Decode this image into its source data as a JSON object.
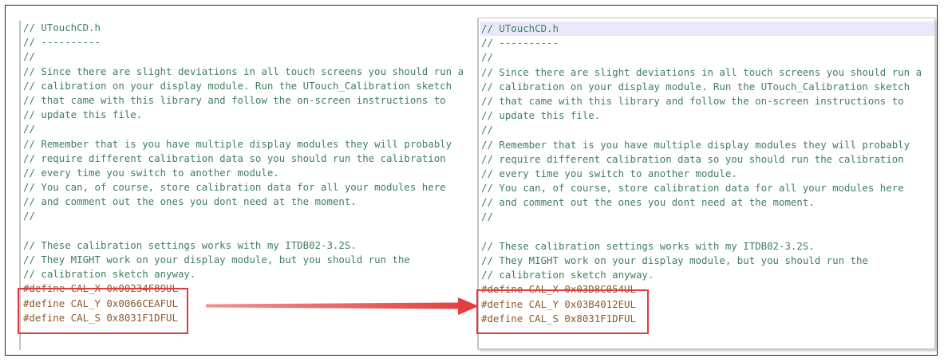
{
  "left_editor": {
    "lines": [
      "// UTouchCD.h",
      "// ----------",
      "//",
      "// Since there are slight deviations in all touch screens you should run a",
      "// calibration on your display module. Run the UTouch_Calibration sketch",
      "// that came with this library and follow the on-screen instructions to",
      "// update this file.",
      "//",
      "// Remember that is you have multiple display modules they will probably",
      "// require different calibration data so you should run the calibration",
      "// every time you switch to another module.",
      "// You can, of course, store calibration data for all your modules here",
      "// and comment out the ones you dont need at the moment.",
      "//",
      "",
      "// These calibration settings works with my ITDB02-3.2S.",
      "// They MIGHT work on your display module, but you should run the",
      "// calibration sketch anyway.",
      "#define CAL_X 0x00234F89UL",
      "#define CAL_Y 0x0066CEAFUL",
      "#define CAL_S 0x8031F1DFUL"
    ]
  },
  "right_editor": {
    "lines": [
      "// UTouchCD.h",
      "// ----------",
      "//",
      "// Since there are slight deviations in all touch screens you should run a",
      "// calibration on your display module. Run the UTouch_Calibration sketch",
      "// that came with this library and follow the on-screen instructions to",
      "// update this file.",
      "//",
      "// Remember that is you have multiple display modules they will probably",
      "// require different calibration data so you should run the calibration",
      "// every time you switch to another module.",
      "// You can, of course, store calibration data for all your modules here",
      "// and comment out the ones you dont need at the moment.",
      "//",
      "",
      "// These calibration settings works with my ITDB02-3.2S.",
      "// They MIGHT work on your display module, but you should run the",
      "// calibration sketch anyway.",
      "#define CAL_X 0x03D8C054UL",
      "#define CAL_Y 0x03B4012EUL",
      "#define CAL_S 0x8031F1DFUL"
    ]
  },
  "colors": {
    "comment": "#3f7f5f",
    "define": "#8b5a2b",
    "highlight": "#e23b3b",
    "current_line": "#e8e8fa"
  }
}
